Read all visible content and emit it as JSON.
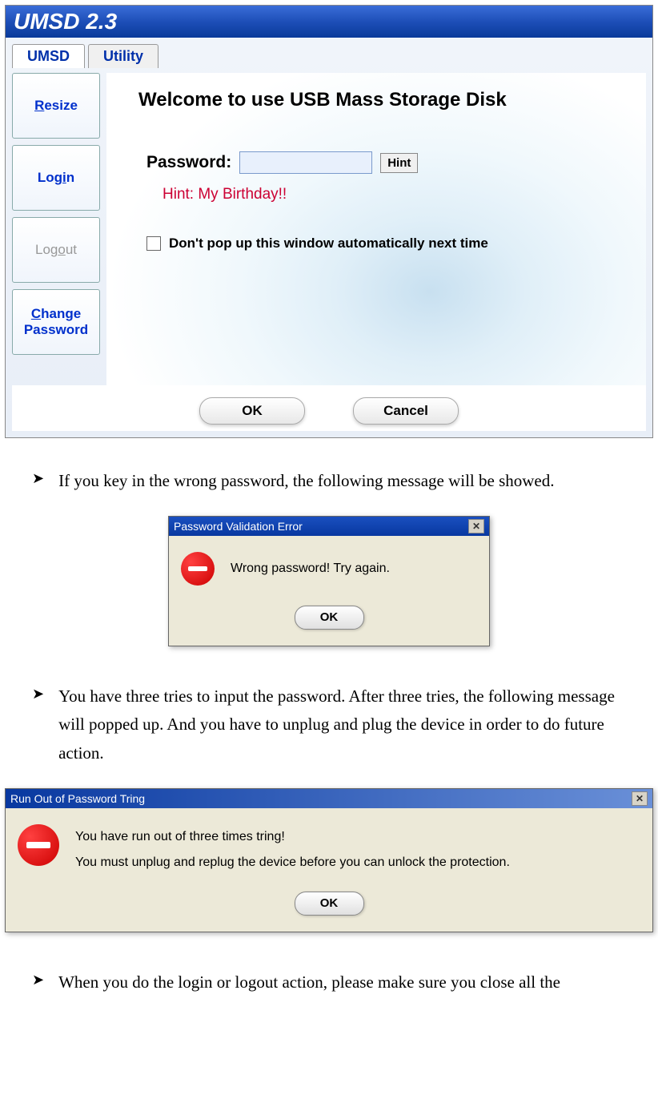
{
  "main_window": {
    "title": "UMSD 2.3",
    "tabs": {
      "umsd": "UMSD",
      "utility": "Utility"
    },
    "side_buttons": {
      "resize": "Resize",
      "login": "Login",
      "logout": "Logout",
      "change_password": "Change Password"
    },
    "panel": {
      "welcome": "Welcome to use USB Mass Storage Disk",
      "password_label": "Password:",
      "hint_button": "Hint",
      "hint_text": "Hint: My Birthday!!",
      "checkbox_label": "Don't pop up this window automatically next time"
    },
    "buttons": {
      "ok": "OK",
      "cancel": "Cancel"
    }
  },
  "doc": {
    "bullet1": "If you key in the wrong password, the following message will be showed.",
    "bullet2": "You have three tries to input the password. After three tries, the following message will popped up. And you have to unplug and plug the device in order to do future action.",
    "bullet3": "When you do the login or logout action, please make sure you close all the"
  },
  "dialog1": {
    "title": "Password Validation Error",
    "message": "Wrong password! Try again.",
    "ok": "OK"
  },
  "dialog2": {
    "title": "Run Out of Password Tring",
    "message1": "You have run out of three times tring!",
    "message2": "You must unplug and replug the device before you can unlock the protection.",
    "ok": "OK"
  },
  "close_x": "✕",
  "bullet_symbol": "➤"
}
